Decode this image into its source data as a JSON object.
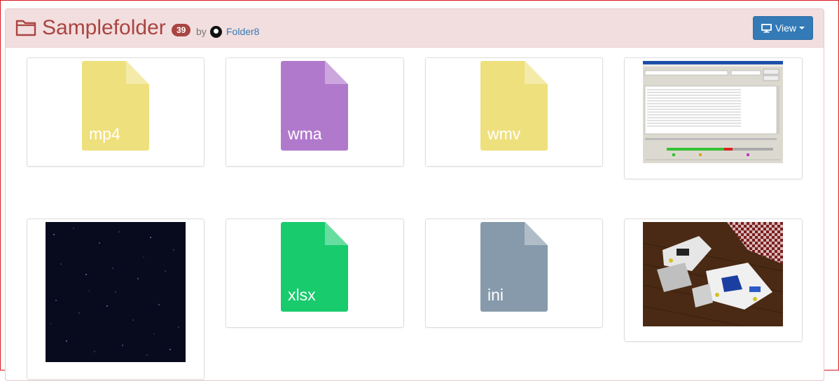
{
  "folder": {
    "title": "Samplefolder",
    "count": "39",
    "by_label": "by",
    "owner": "Folder8",
    "icon": "folder-open-icon"
  },
  "toolbar": {
    "view_label": "View",
    "view_icon": "monitor-icon"
  },
  "items": [
    {
      "kind": "file",
      "ext": "mp4",
      "color": "#efe07e"
    },
    {
      "kind": "file",
      "ext": "wma",
      "color": "#b179cc"
    },
    {
      "kind": "file",
      "ext": "wmv",
      "color": "#efe07e"
    },
    {
      "kind": "image",
      "subject": "application-window-screenshot"
    },
    {
      "kind": "image",
      "subject": "starfield"
    },
    {
      "kind": "file",
      "ext": "xlsx",
      "color": "#18cb6d"
    },
    {
      "kind": "file",
      "ext": "ini",
      "color": "#869aab"
    },
    {
      "kind": "image",
      "subject": "toy-spaceship-photo"
    }
  ],
  "colors": {
    "heading_bg": "#f2dede",
    "title": "#a94442",
    "button": "#337ab7"
  }
}
